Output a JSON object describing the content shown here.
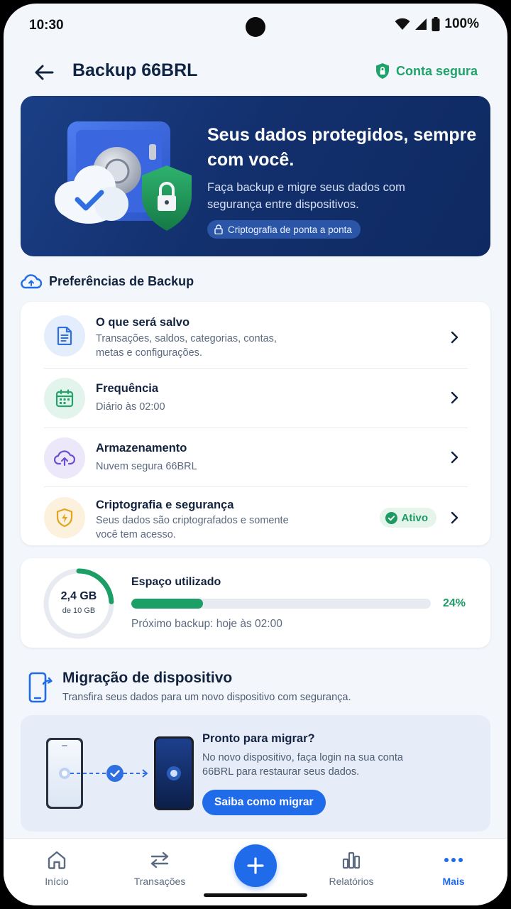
{
  "status": {
    "time": "10:30",
    "battery": "100%"
  },
  "header": {
    "title": "Backup 66BRL",
    "secure_label": "Conta segura"
  },
  "hero": {
    "title": "Seus dados protegidos, sempre com você.",
    "subtitle": "Faça backup e migre seus dados com segurança entre dispositivos.",
    "chip": "Criptografia de ponta a ponta"
  },
  "prefs": {
    "heading": "Preferências de Backup",
    "items": [
      {
        "label": "O que será salvo",
        "desc": "Transações, saldos, categorias, contas, metas e configurações.",
        "icon": "document-icon"
      },
      {
        "label": "Frequência",
        "desc": "Diário às 02:00",
        "icon": "calendar-icon"
      },
      {
        "label": "Armazenamento",
        "desc": "Nuvem segura 66BRL",
        "icon": "cloud-upload-icon"
      },
      {
        "label": "Criptografia e segurança",
        "desc": "Seus dados são criptografados e somente você tem acesso.",
        "icon": "shield-icon",
        "badge": "Ativo"
      }
    ]
  },
  "storage": {
    "used": "2,4 GB",
    "total": "de 10 GB",
    "title": "Espaço utilizado",
    "percent_label": "24%",
    "percent": 0.24,
    "next_backup": "Próximo backup: hoje às 02:00"
  },
  "migration": {
    "title": "Migração de dispositivo",
    "subtitle": "Transfira seus dados para um novo dispositivo com segurança.",
    "ready_title": "Pronto para migrar?",
    "ready_desc": "No novo dispositivo, faça login na sua conta 66BRL para restaurar seus dados.",
    "button": "Saiba como migrar"
  },
  "nav": {
    "items": [
      {
        "label": "Início",
        "icon": "home-icon"
      },
      {
        "label": "Transações",
        "icon": "transfer-icon"
      },
      {
        "label": "Relatórios",
        "icon": "bar-chart-icon"
      },
      {
        "label": "Mais",
        "icon": "more-icon",
        "active": true
      }
    ]
  },
  "colors": {
    "accent": "#1f6bea",
    "success": "#1c9e67",
    "hero_bg": "#13306e"
  }
}
